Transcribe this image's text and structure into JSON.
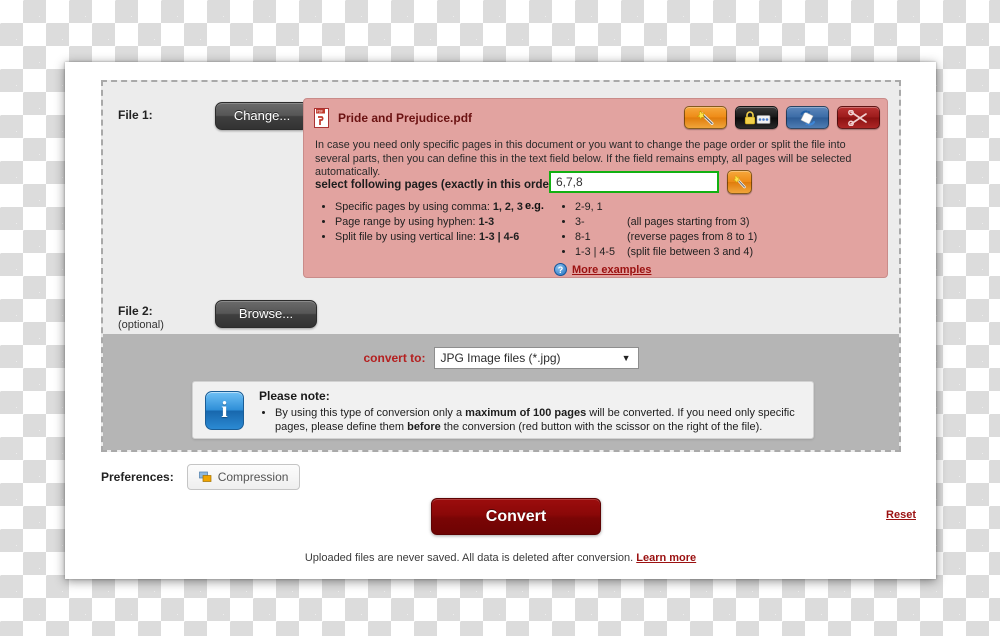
{
  "file1": {
    "label": "File 1:",
    "change_button": "Change...",
    "remove_icon": "close-x-icon"
  },
  "file2": {
    "label": "File 2:",
    "optional": "(optional)",
    "browse_button": "Browse..."
  },
  "pdf": {
    "filename": "Pride and Prejudice.pdf",
    "description": "In case you need only specific pages in this document or you want to change the page order or split the file into several parts, then you can define this in the text field below. If the field remains empty, all pages will be selected automatically.",
    "select_label": "select following pages (exactly in this order):",
    "pages_value": "6,7,8",
    "pages_placeholder": "",
    "tools": [
      {
        "name": "magic-wand-icon",
        "title": "optimize"
      },
      {
        "name": "lock-password-icon",
        "title": "protect"
      },
      {
        "name": "rotate-icon",
        "title": "rotate"
      },
      {
        "name": "scissors-icon",
        "title": "split"
      }
    ],
    "examples_left": [
      "Specific pages by using comma: 1, 2, 3",
      "Page range by using hyphen: 1-3",
      "Split file by using vertical line: 1-3 | 4-6"
    ],
    "eg_label": "e.g.",
    "examples_right": [
      {
        "code": "2-9, 1",
        "note": ""
      },
      {
        "code": "3-",
        "note": "(all pages starting from 3)"
      },
      {
        "code": "8-1",
        "note": "(reverse pages from 8 to 1)"
      },
      {
        "code": "1-3 | 4-5",
        "note": "(split file between 3 and 4)"
      }
    ],
    "more_examples": "More examples"
  },
  "convert": {
    "label": "convert to:",
    "selected_format": "JPG Image files (*.jpg)",
    "caret": "▼",
    "button_label": "Convert"
  },
  "note": {
    "title": "Please note:",
    "body_parts": [
      {
        "text": "By using this type of conversion only a ",
        "bold": false
      },
      {
        "text": "maximum of 100 pages",
        "bold": true
      },
      {
        "text": " will be converted. If you need only specific pages, please define them ",
        "bold": false
      },
      {
        "text": "before",
        "bold": true
      },
      {
        "text": " the conversion (red button with the scissor on the right of the file).",
        "bold": false
      }
    ],
    "icon": "info-icon"
  },
  "preferences": {
    "label": "Preferences:",
    "compression_button": "Compression"
  },
  "reset_link": "Reset",
  "footer": {
    "text": "Uploaded files are never saved. All data is deleted after conversion. ",
    "link": "Learn more"
  },
  "colors": {
    "pink_box": "#e2a3a0",
    "convert_red": "#8a0808",
    "link_red": "#9b1111",
    "input_green": "#12b012",
    "gray_band": "#b5b5b5"
  }
}
